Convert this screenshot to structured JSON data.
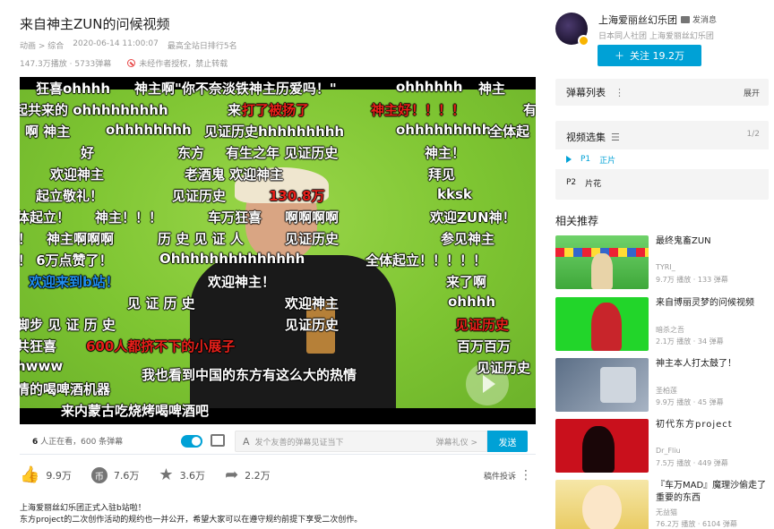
{
  "video": {
    "title": "来自神主ZUN的问候视频",
    "category": "动画 > 综合",
    "date": "2020-06-14 11:00:07",
    "rank": "最高全站日排行5名",
    "plays": "147.3万播放 · 5733弹幕",
    "copyright": "未经作者授权，禁止转载"
  },
  "danmaku": [
    {
      "text": "狂喜ohhhh",
      "color": "white"
    },
    {
      "text": "神主啊\"你不奈淡铁神主历爱吗！\"",
      "color": "white"
    },
    {
      "text": "ohhhhhh",
      "color": "white"
    },
    {
      "text": "神主",
      "color": "white"
    },
    {
      "text": "起共来的 ohhhhhhhhh",
      "color": "white"
    },
    {
      "text": "来",
      "color": "white"
    },
    {
      "text": "打了被扬了",
      "color": "red"
    },
    {
      "text": "神主好！！！！",
      "color": "red"
    },
    {
      "text": "有",
      "color": "white"
    },
    {
      "text": "啊  神主",
      "color": "white"
    },
    {
      "text": "ohhhhhhhh",
      "color": "white"
    },
    {
      "text": "见证历史hhhhhhhhh",
      "color": "white"
    },
    {
      "text": "ohhhhhhhhh",
      "color": "white"
    },
    {
      "text": "全体起",
      "color": "white"
    },
    {
      "text": "好",
      "color": "white"
    },
    {
      "text": "东方",
      "color": "white"
    },
    {
      "text": "有生之年 见证历史",
      "color": "white"
    },
    {
      "text": "神主！",
      "color": "white"
    },
    {
      "text": "欢迎神主",
      "color": "white"
    },
    {
      "text": "老酒鬼 欢迎神主",
      "color": "white"
    },
    {
      "text": "拜见",
      "color": "white"
    },
    {
      "text": "起立敬礼！",
      "color": "white"
    },
    {
      "text": "见证历史",
      "color": "white"
    },
    {
      "text": "130.8万",
      "color": "red"
    },
    {
      "text": "kksk",
      "color": "white"
    },
    {
      "text": "体起立！",
      "color": "white"
    },
    {
      "text": "神主！！！",
      "color": "white"
    },
    {
      "text": "车万狂喜",
      "color": "white"
    },
    {
      "text": "啊啊啊啊",
      "color": "white"
    },
    {
      "text": "欢迎ZUN神！",
      "color": "white"
    },
    {
      "text": "！",
      "color": "white"
    },
    {
      "text": "神主啊啊啊",
      "color": "white"
    },
    {
      "text": "历 史 见 证 人",
      "color": "white"
    },
    {
      "text": "见证历史",
      "color": "white"
    },
    {
      "text": "参见神主",
      "color": "white"
    },
    {
      "text": "！ 6万点赞了！",
      "color": "white"
    },
    {
      "text": "Ohhhhhhhhhhhhhh",
      "color": "white"
    },
    {
      "text": "全体起立！！！！！",
      "color": "white"
    },
    {
      "text": "欢迎来到b站！",
      "color": "blue"
    },
    {
      "text": "欢迎神主！",
      "color": "white"
    },
    {
      "text": "来了啊",
      "color": "white"
    },
    {
      "text": "见 证 历 史",
      "color": "white"
    },
    {
      "text": "欢迎神主",
      "color": "white"
    },
    {
      "text": "ohhhh",
      "color": "white"
    },
    {
      "text": "脚步 见  证  历  史",
      "color": "white"
    },
    {
      "text": "见证历史",
      "color": "white"
    },
    {
      "text": "见证历史",
      "color": "red"
    },
    {
      "text": "共狂喜",
      "color": "white"
    },
    {
      "text": "600人都挤不下的小展子",
      "color": "red"
    },
    {
      "text": "百万百万",
      "color": "white"
    },
    {
      "text": "hwww",
      "color": "white"
    },
    {
      "text": "见证历史",
      "color": "white"
    },
    {
      "text": "我也看到中国的东方有这么大的热情",
      "color": "white"
    },
    {
      "text": "情的喝啤酒机器",
      "color": "white"
    },
    {
      "text": "来内蒙古吃烧烤喝啤酒吧",
      "color": "white"
    }
  ],
  "danmaku_bar": {
    "watching_count": "6",
    "watching_text": "人正在看，600 条弹幕",
    "input_placeholder": "发个友善的弹幕见证当下",
    "etiquette": "弹幕礼仪 >",
    "send_label": "发送"
  },
  "actions": {
    "like": "9.9万",
    "coin": "7.6万",
    "favorite": "3.6万",
    "share": "2.2万",
    "report": "稿件投诉",
    "coin_glyph": "币"
  },
  "description": {
    "line1": "上海爱丽丝幻乐团正式入驻b站啦！",
    "line2": "东方project的二次创作活动的规约也一并公开，希望大家可以在遵守规约前提下享受二次创作。"
  },
  "uploader": {
    "name": "上海爱丽丝幻乐团",
    "message": "发消息",
    "sign": "日本同人社团 上海爱丽丝幻乐团",
    "follow_label": "关注 19.2万"
  },
  "danmaku_list": {
    "label": "弹幕列表",
    "expand": "展开"
  },
  "episodes": {
    "title": "视频选集",
    "count": "1/2",
    "items": [
      {
        "num": "P1",
        "name": "正片"
      },
      {
        "num": "P2",
        "name": "片花"
      }
    ]
  },
  "recommend": {
    "title": "相关推荐",
    "items": [
      {
        "title": "最终鬼畜ZUN",
        "author": "TYRI_",
        "stats": "9.7万 播放 · 133 弹幕"
      },
      {
        "title": "来自博丽灵梦的问候视频",
        "author": "暗杀之吾",
        "stats": "2.1万 播放 · 34 弹幕"
      },
      {
        "title": "神主本人打太鼓了！",
        "author": "圣柏莲",
        "stats": "9.9万 播放 · 45 弹幕"
      },
      {
        "title": "初代东方project",
        "author": "Dr_Fliu",
        "stats": "7.5万 播放 · 449 弹幕"
      },
      {
        "title": "『车万MAD』魔理沙偷走了重要的东西",
        "author": "无益猫",
        "stats": "76.2万 播放 · 6104 弹幕"
      }
    ]
  }
}
